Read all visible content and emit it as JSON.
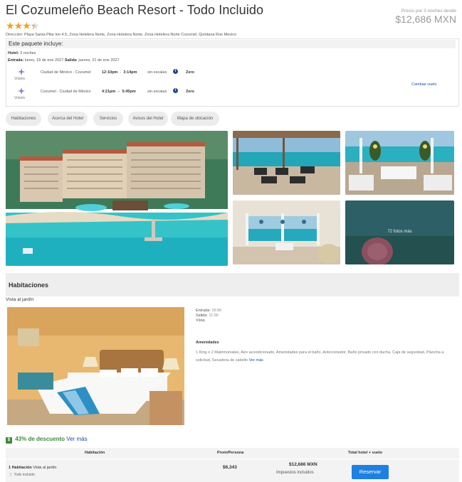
{
  "hotel": {
    "name": "El Cozumeleño Beach Resort - Todo Incluido",
    "address": "Dirección: Playa Santa Pilar km 4.5, Zona Hotelera Norte, Zona Hotelera Norte, Zona Hotelera Norte Cozumel, Quintana Roo Mexico",
    "star_rating": 3.5
  },
  "price": {
    "caption": "Precio por 3 noches desde",
    "amount": "$12,686 MXN"
  },
  "package": {
    "header": "Este paquete incluye:",
    "hotel_label": "Hotel:",
    "hotel_value": "3 noches",
    "entry_label": "Entrada:",
    "entry_value": "lunes, 18 de ene 2027",
    "exit_label": "Salida:",
    "exit_value": "jueves, 21 de ene 2027",
    "flights": [
      {
        "airline": "Volaris",
        "route": "Ciudad de México - Cozumel",
        "depart": "12:10pm",
        "sep": "-",
        "arrive": "3:14pm",
        "stops": "sin escalas",
        "fare": "Zero"
      },
      {
        "airline": "Volaris",
        "route": "Cozumel - Ciudad de México",
        "depart": "4:21pm",
        "sep": "–",
        "arrive": "5:45pm",
        "stops": "sin escalas",
        "fare": "Zero"
      }
    ],
    "change_flight": "Cambiar vuelo"
  },
  "tabs": [
    "Habitaciones",
    "Acerca del Hotel",
    "Servicios",
    "Avisos del Hotel",
    "Mapa de ubicación"
  ],
  "gallery": {
    "more_photos": "72 fotos más"
  },
  "rooms": {
    "header": "Habitaciones",
    "room_name": "Vista al jardín",
    "checkin_label": "Entrada:",
    "checkin_value": "15:00",
    "checkout_label": "Salida:",
    "checkout_value": "11:00",
    "view_label": "Vista:",
    "amenities_title": "Amenidades",
    "amenities_text": "1 King o 2 Matrimoniales, Aire acondicionado, Amenidades para el baño, Antecomedor, Baño privado con ducha, Caja de seguridad, Plancha a solicitud, Secadora de cabello",
    "amenities_more": "Ver más"
  },
  "discount": {
    "icon": "$",
    "percent": "43% de descuento",
    "more": "Ver más"
  },
  "table": {
    "headers": [
      "Habitación",
      "Prom/Persona",
      "Total hotel + vuelo"
    ],
    "row": {
      "qty": "1 Habitación",
      "room": "Vista al jardín",
      "included": "Todo incluido",
      "per_person": "$6,343",
      "total": "$12,686 MXN",
      "taxes": "Impuestos incluidos",
      "reserve": "Reservar"
    }
  },
  "colors": {
    "star": "#f0a030",
    "link": "#1a4fa0",
    "discount_green": "#3b8c3b",
    "reserve_button": "#1e80e0"
  }
}
